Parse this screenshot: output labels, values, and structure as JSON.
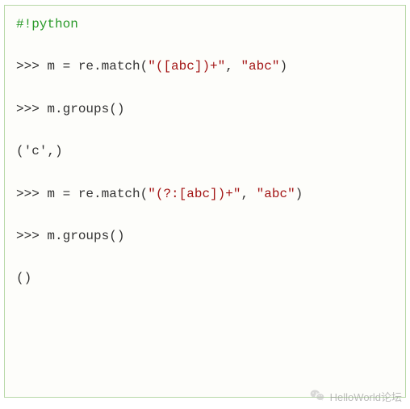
{
  "code": {
    "shebang": "#!python",
    "lines": [
      {
        "type": "input",
        "prompt": ">>> ",
        "tokens": [
          {
            "t": "m ",
            "cls": "ident"
          },
          {
            "t": "=",
            "cls": "op"
          },
          {
            "t": " re.match(",
            "cls": "ident"
          },
          {
            "t": "\"([abc])+\"",
            "cls": "string"
          },
          {
            "t": ", ",
            "cls": "punct"
          },
          {
            "t": "\"abc\"",
            "cls": "string"
          },
          {
            "t": ")",
            "cls": "punct"
          }
        ]
      },
      {
        "type": "input",
        "prompt": ">>> ",
        "tokens": [
          {
            "t": "m.groups()",
            "cls": "ident"
          }
        ]
      },
      {
        "type": "output",
        "text": "('c',)"
      },
      {
        "type": "input",
        "prompt": ">>> ",
        "tokens": [
          {
            "t": "m ",
            "cls": "ident"
          },
          {
            "t": "=",
            "cls": "op"
          },
          {
            "t": " re.match(",
            "cls": "ident"
          },
          {
            "t": "\"(?:[abc])+\"",
            "cls": "string"
          },
          {
            "t": ", ",
            "cls": "punct"
          },
          {
            "t": "\"abc\"",
            "cls": "string"
          },
          {
            "t": ")",
            "cls": "punct"
          }
        ]
      },
      {
        "type": "input",
        "prompt": ">>> ",
        "tokens": [
          {
            "t": "m.groups()",
            "cls": "ident"
          }
        ]
      },
      {
        "type": "output",
        "text": "()"
      }
    ]
  },
  "watermark": {
    "label": "HelloWorld论坛"
  }
}
